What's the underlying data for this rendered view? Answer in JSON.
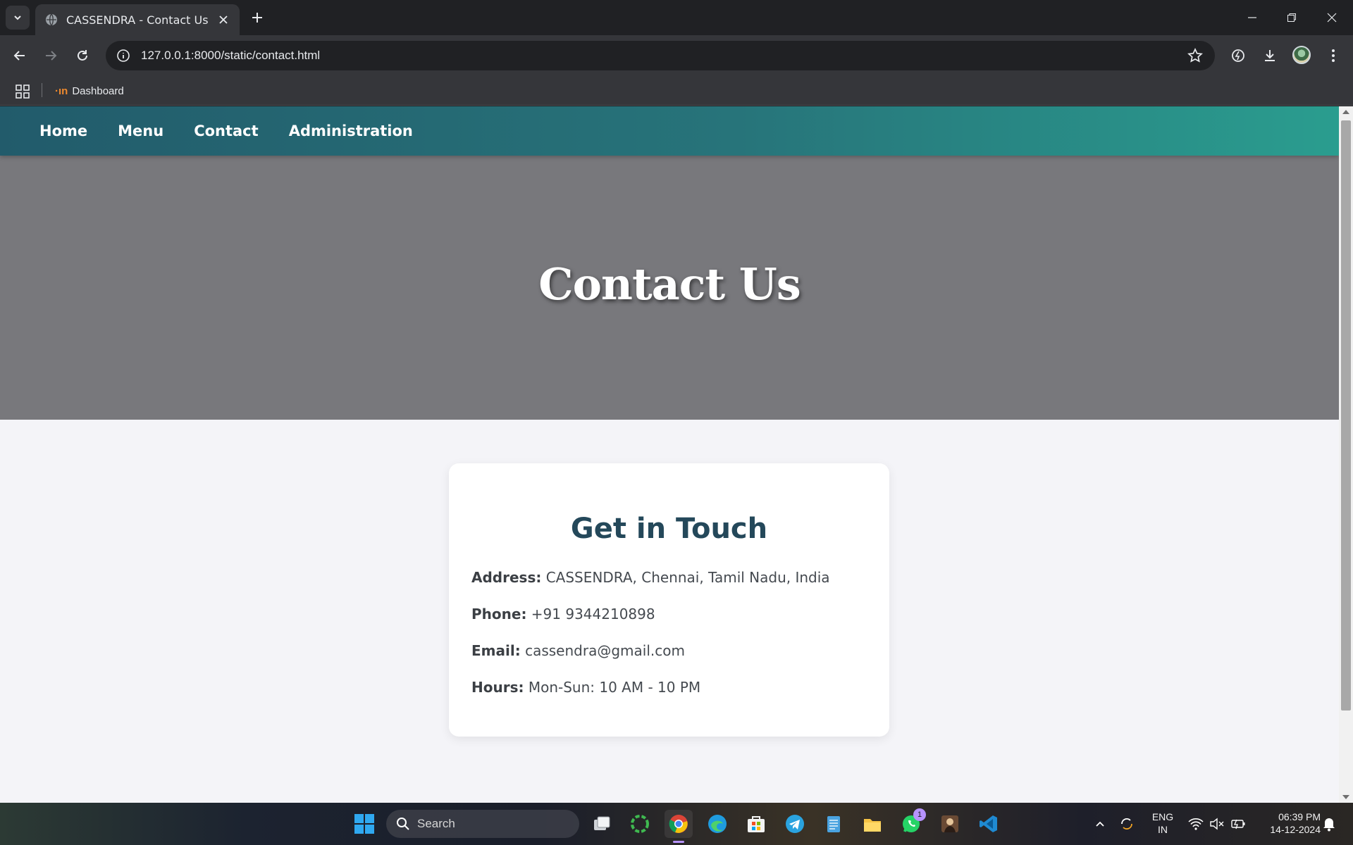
{
  "browser": {
    "tab_title": "CASSENDRA - Contact Us",
    "url": "127.0.0.1:8000/static/contact.html",
    "bookmarks": [
      {
        "label": "Dashboard"
      }
    ]
  },
  "site": {
    "nav": [
      "Home",
      "Menu",
      "Contact",
      "Administration"
    ],
    "hero_title": "Contact Us",
    "card": {
      "heading": "Get in Touch",
      "rows": [
        {
          "label": "Address:",
          "value": " CASSENDRA, Chennai, Tamil Nadu, India"
        },
        {
          "label": "Phone:",
          "value": " +91 9344210898"
        },
        {
          "label": "Email:",
          "value": " cassendra@gmail.com"
        },
        {
          "label": "Hours:",
          "value": " Mon-Sun: 10 AM - 10 PM"
        }
      ]
    }
  },
  "taskbar": {
    "search_label": "Search",
    "whatsapp_badge": "1",
    "lang_line1": "ENG",
    "lang_line2": "IN",
    "time": "06:39 PM",
    "date": "14-12-2024"
  },
  "colors": {
    "nav_gradient_start": "#225b6b",
    "nav_gradient_end": "#2a9d8f",
    "hero_bg": "#78787c",
    "heading": "#24485a",
    "page_bg": "#f4f4f8"
  }
}
